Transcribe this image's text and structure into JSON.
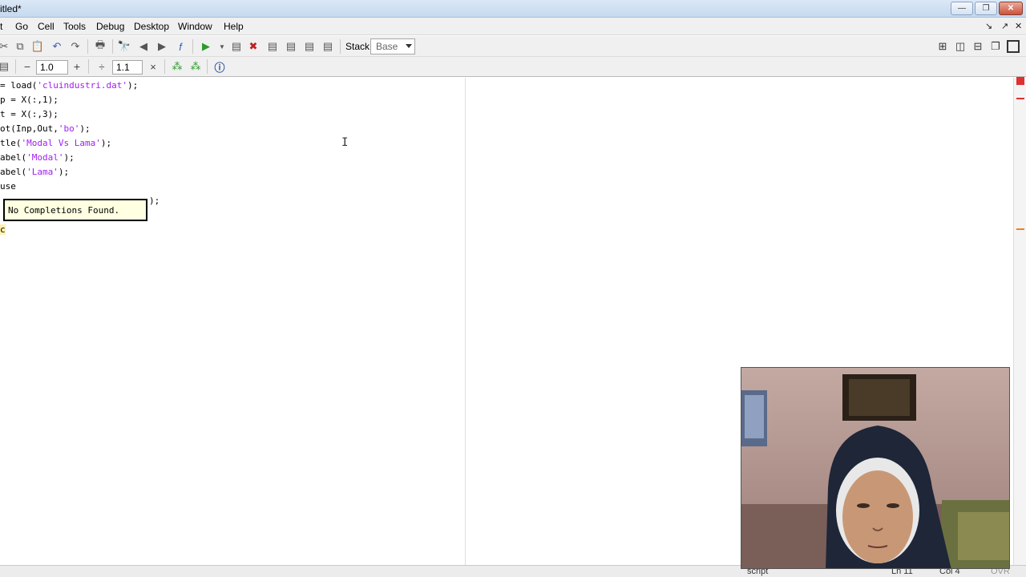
{
  "window": {
    "title": "itled*",
    "buttons": {
      "minimize": "—",
      "restore": "❐",
      "close": "✕"
    }
  },
  "menu": {
    "items": [
      "t",
      "Go",
      "Cell",
      "Tools",
      "Debug",
      "Desktop",
      "Window",
      "Help"
    ],
    "undock_icons": [
      "↘",
      "↗",
      "✕"
    ]
  },
  "toolbar": {
    "stack_label": "Stack:",
    "stack_value": "Base",
    "cell_minus": "−",
    "cell_value_1": "1.0",
    "cell_plus": "+",
    "cell_divide": "÷",
    "cell_value_2": "1.1",
    "cell_times": "×"
  },
  "editor": {
    "lines": [
      {
        "prefix": "= load(",
        "str": "'cluindustri.dat'",
        "suffix": ");"
      },
      {
        "prefix": "p = X(:,1);",
        "str": "",
        "suffix": ""
      },
      {
        "prefix": "t = X(:,3);",
        "str": "",
        "suffix": ""
      },
      {
        "prefix": "ot(Inp,Out,",
        "str": "'bo'",
        "suffix": ");"
      },
      {
        "prefix": "tle(",
        "str": "'Modal Vs Lama'",
        "suffix": ");"
      },
      {
        "prefix": "abel(",
        "str": "'Modal'",
        "suffix": ");"
      },
      {
        "prefix": "abel(",
        "str": "'Lama'",
        "suffix": ");"
      },
      {
        "prefix": "use",
        "str": "",
        "suffix": ""
      },
      {
        "prefix": "",
        "str": "",
        "suffix": ");"
      },
      {
        "prefix": "",
        "str": "",
        "suffix": ""
      },
      {
        "prefix": "c",
        "str": "",
        "suffix": ""
      }
    ],
    "tooltip": "No Completions Found.",
    "ibeam": "I"
  },
  "status": {
    "mode": "script",
    "line": "Ln 11",
    "col": "Col 4",
    "ovr": "OVR"
  },
  "colors": {
    "string": "#a020f0",
    "tooltip_bg": "#ffffe1",
    "indicator_red": "#e03030",
    "indicator_orange": "#f08020"
  }
}
